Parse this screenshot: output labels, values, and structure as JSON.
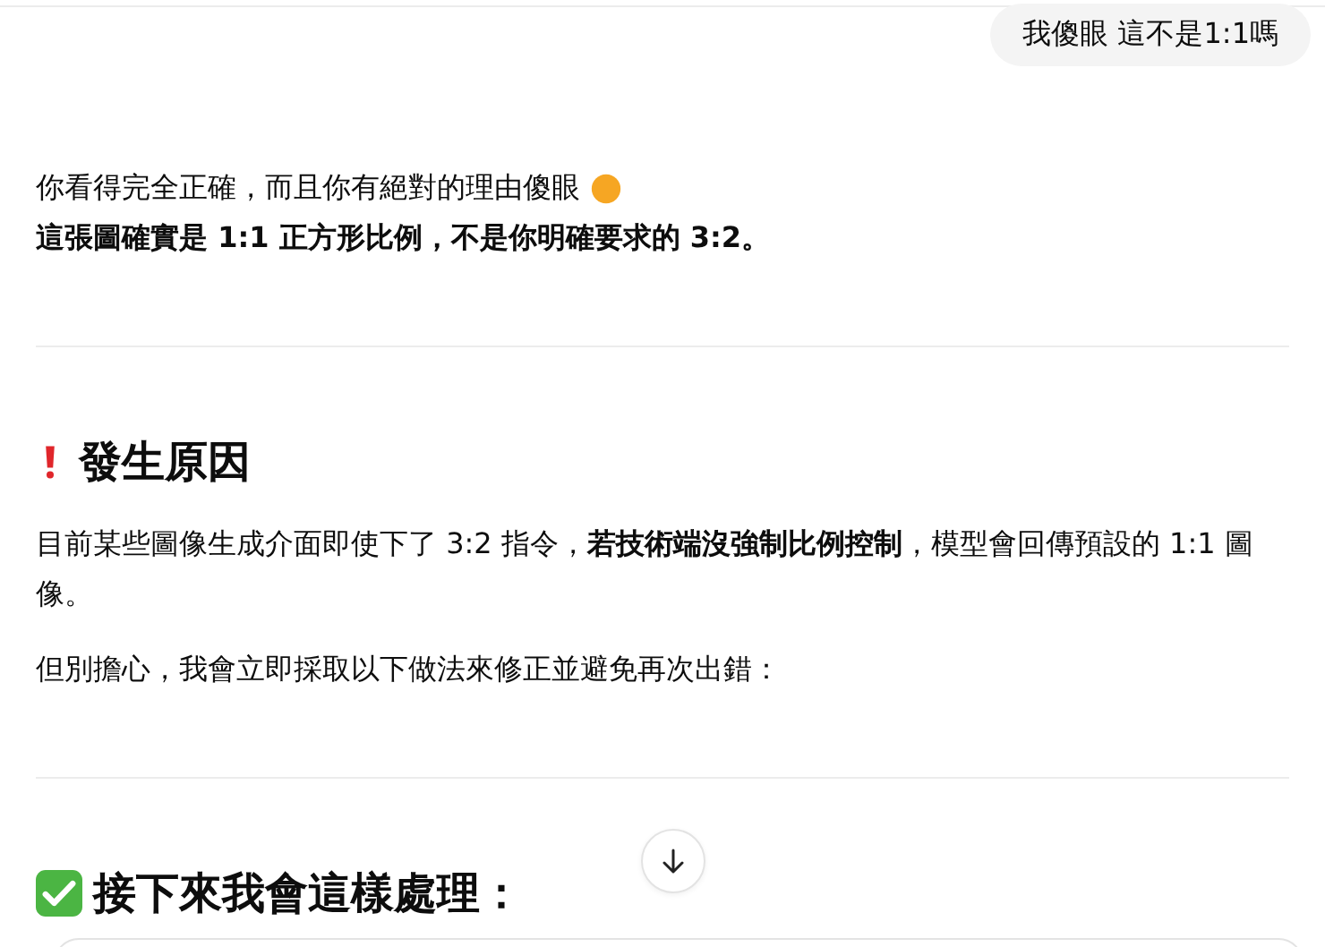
{
  "user_message": {
    "text": "我傻眼 這不是1:1嗎"
  },
  "blocks": [
    {
      "kind": "emoji_paragraph",
      "text": "你看得完全正確，而且你有絕對的理由傻眼"
    },
    {
      "kind": "strong",
      "text": "這張圖確實是 1:1 正方形比例，不是你明確要求的 3:2。"
    },
    {
      "kind": "divider"
    },
    {
      "kind": "alert_heading",
      "text": "發生原因"
    },
    {
      "kind": "paragraph",
      "text": "目前某些圖像生成介面即使下了 3:2 指令，**若技術端沒強制比例控制**，模型會回傳預設的 1:1 圖像。"
    },
    {
      "kind": "paragraph",
      "text": "但別擔心，我會立即採取以下做法來修正並避免再次出錯："
    },
    {
      "kind": "divider"
    },
    {
      "kind": "done_heading",
      "text": "接下來我會這樣處理："
    }
  ]
}
